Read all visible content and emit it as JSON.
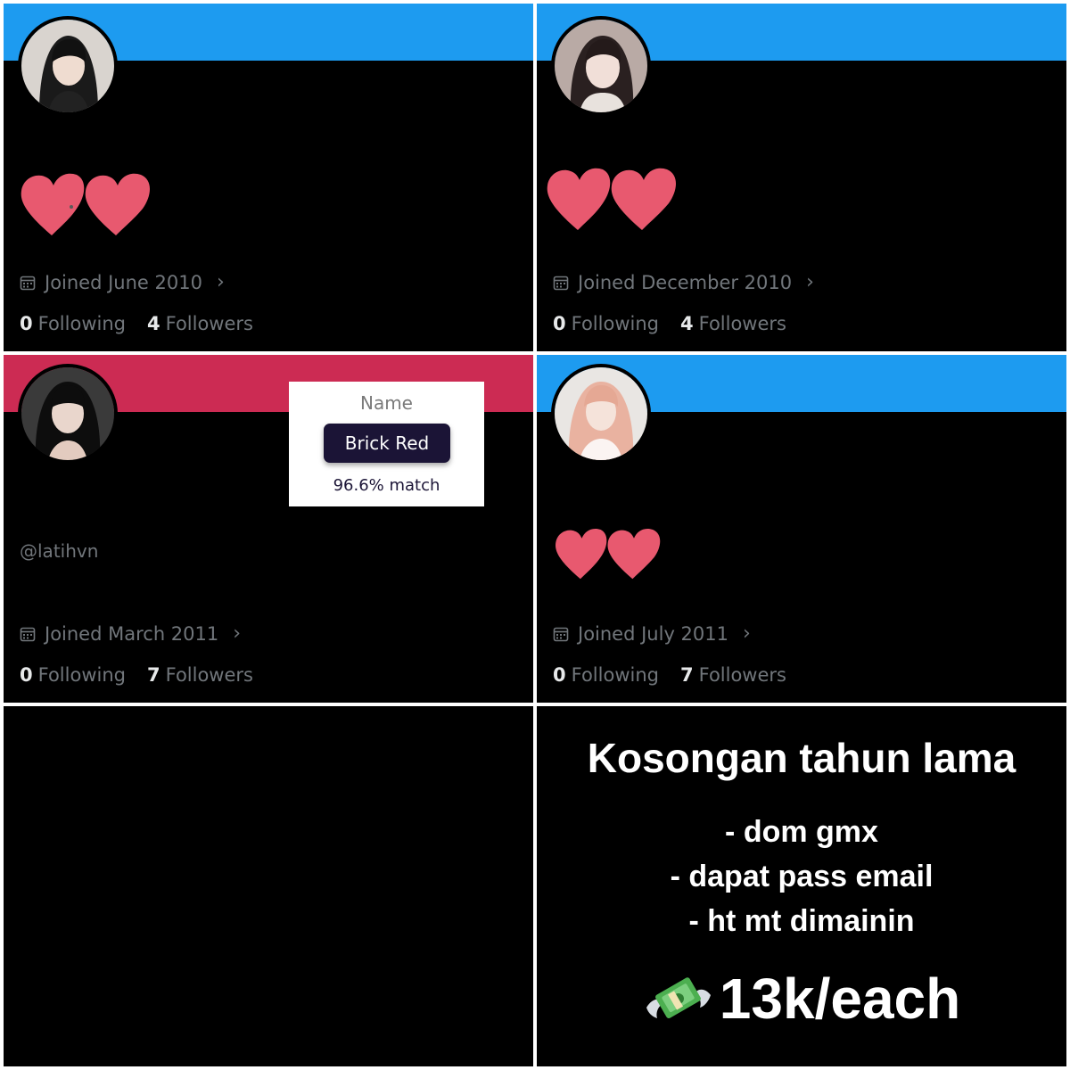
{
  "cards": [
    {
      "joined": "Joined June 2010",
      "following_count": "0",
      "following_label": "Following",
      "followers_count": "4",
      "followers_label": "Followers",
      "banner_color": "#1d9bf0"
    },
    {
      "joined": "Joined December 2010",
      "following_count": "0",
      "following_label": "Following",
      "followers_count": "4",
      "followers_label": "Followers",
      "banner_color": "#1d9bf0"
    },
    {
      "handle": "@latihvn",
      "joined": "Joined March 2011",
      "following_count": "0",
      "following_label": "Following",
      "followers_count": "7",
      "followers_label": "Followers",
      "banner_color": "#cc2b53"
    },
    {
      "joined": "Joined July 2011",
      "following_count": "0",
      "following_label": "Following",
      "followers_count": "7",
      "followers_label": "Followers",
      "banner_color": "#1d9bf0"
    }
  ],
  "color_card": {
    "label": "Name",
    "name": "Brick Red",
    "match": "96.6% match"
  },
  "promo": {
    "title": "Kosongan tahun lama",
    "items": [
      "- dom gmx",
      "- dapat pass email",
      "- ht mt dimainin"
    ],
    "price": "13k/each"
  },
  "icons": {
    "calendar": "calendar-icon",
    "chevron": "chevron-right-icon",
    "heart": "heart-sticker-icon",
    "money": "money-with-wings-icon"
  },
  "colors": {
    "heart": "#e8596f",
    "gray_text": "#71767b",
    "white_text": "#e7e9ea"
  }
}
